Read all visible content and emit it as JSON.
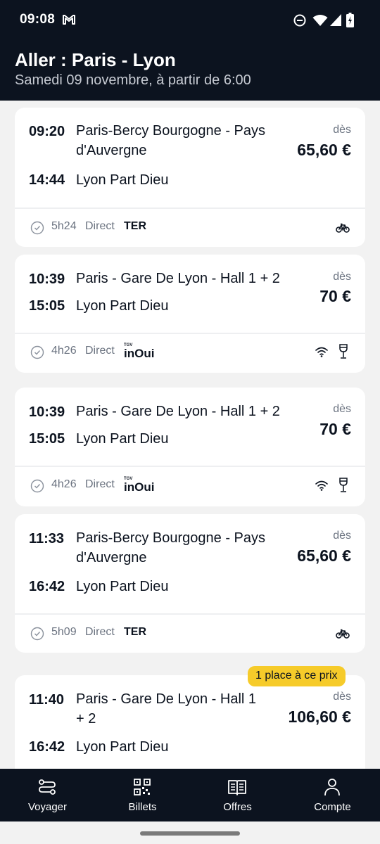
{
  "status_bar": {
    "time": "09:08"
  },
  "header": {
    "title": "Aller : Paris - Lyon",
    "subtitle": "Samedi 09 novembre, à partir de 6:00"
  },
  "trips": [
    {
      "depart_time": "09:20",
      "depart_station": "Paris-Bercy Bourgogne - Pays d'Auvergne",
      "arrive_time": "14:44",
      "arrive_station": "Lyon Part Dieu",
      "from_label": "dès",
      "price": "65,60 €",
      "duration": "5h24",
      "direct": "Direct",
      "train_type": "TER",
      "services": [
        "bike-icon"
      ]
    },
    {
      "depart_time": "10:39",
      "depart_station": "Paris - Gare De Lyon - Hall 1 + 2",
      "arrive_time": "15:05",
      "arrive_station": "Lyon Part Dieu",
      "from_label": "dès",
      "price": "70 €",
      "duration": "4h26",
      "direct": "Direct",
      "train_type": "TGV INOUI",
      "services": [
        "wifi-icon",
        "bar-icon"
      ]
    },
    {
      "depart_time": "10:39",
      "depart_station": "Paris - Gare De Lyon - Hall 1 + 2",
      "arrive_time": "15:05",
      "arrive_station": "Lyon Part Dieu",
      "from_label": "dès",
      "price": "70 €",
      "duration": "4h26",
      "direct": "Direct",
      "train_type": "TGV INOUI",
      "services": [
        "wifi-icon",
        "bar-icon"
      ]
    },
    {
      "depart_time": "11:33",
      "depart_station": "Paris-Bercy Bourgogne - Pays d'Auvergne",
      "arrive_time": "16:42",
      "arrive_station": "Lyon Part Dieu",
      "from_label": "dès",
      "price": "65,60 €",
      "duration": "5h09",
      "direct": "Direct",
      "train_type": "TER",
      "services": [
        "bike-icon"
      ]
    },
    {
      "depart_time": "11:40",
      "depart_station": "Paris - Gare De Lyon - Hall 1 + 2",
      "arrive_time": "16:42",
      "arrive_station": "Lyon Part Dieu",
      "from_label": "dès",
      "price": "106,60 €",
      "badge": "1 place à ce prix"
    }
  ],
  "nav": [
    {
      "label": "Voyager",
      "icon": "route-icon"
    },
    {
      "label": "Billets",
      "icon": "qr-code-icon"
    },
    {
      "label": "Offres",
      "icon": "open-book-icon"
    },
    {
      "label": "Compte",
      "icon": "person-icon"
    }
  ],
  "colors": {
    "header_bg": "#0c131f",
    "page_bg": "#f2f2f2",
    "badge_bg": "#f6cb2a",
    "muted_text": "#6b7380"
  }
}
